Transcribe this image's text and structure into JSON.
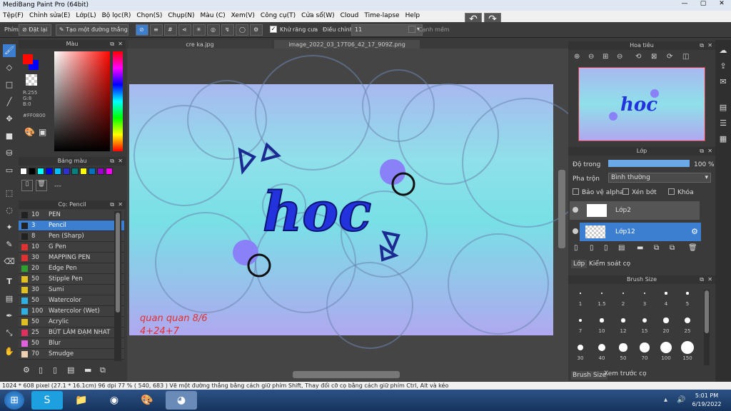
{
  "app": {
    "title": "MediBang Paint Pro (64bit)"
  },
  "window": {
    "minimize": "—",
    "maximize": "▢",
    "close": "✕"
  },
  "menu": [
    "Tệp(F)",
    "Chỉnh sửa(E)",
    "Lớp(L)",
    "Bộ lọc(R)",
    "Chọn(S)",
    "Chụp(N)",
    "Màu (C)",
    "Xem(V)",
    "Công cụ(T)",
    "Cửa sổ(W)",
    "Cloud",
    "Time-lapse",
    "Help"
  ],
  "options": {
    "label_phim": "Phím",
    "reset": "Đặt lại",
    "line": "Tạo một đường thẳng",
    "antialias": "Khử răng cưa",
    "adjust_label": "Điều chỉnh",
    "adjust_value": "11",
    "smooth": "Cạnh mềm"
  },
  "color_panel": {
    "title": "Màu",
    "r": "R:255",
    "g": "G:8",
    "b": "B:0",
    "hex": "#FF0800",
    "primary": "#ff0800",
    "secondary": "#0000ff"
  },
  "palette_panel": {
    "title": "Bảng màu",
    "text": "---",
    "swatches": [
      "#ffffff",
      "#000000",
      "#00ffff",
      "#0000ff",
      "#00bfff",
      "#3030d0",
      "#008080",
      "#ffff00",
      "#0070c0",
      "#9900cc",
      "#ff00ff"
    ]
  },
  "brush_panel": {
    "title": "Cọ: Pencil",
    "items": [
      {
        "size": "10",
        "name": "PEN",
        "color": "#222222"
      },
      {
        "size": "3",
        "name": "Pencil",
        "color": "#222222",
        "selected": true
      },
      {
        "size": "8",
        "name": "Pen (Sharp)",
        "color": "#222222"
      },
      {
        "size": "10",
        "name": "G Pen",
        "color": "#e03030"
      },
      {
        "size": "30",
        "name": "MAPPING PEN",
        "color": "#e03030"
      },
      {
        "size": "20",
        "name": "Edge Pen",
        "color": "#30a030"
      },
      {
        "size": "50",
        "name": "Stipple Pen",
        "color": "#e0c020"
      },
      {
        "size": "30",
        "name": "Sumi",
        "color": "#e0c020"
      },
      {
        "size": "50",
        "name": "Watercolor",
        "color": "#30b0e0"
      },
      {
        "size": "100",
        "name": "Watercolor (Wet)",
        "color": "#30b0e0"
      },
      {
        "size": "50",
        "name": "Acrylic",
        "color": "#e0c020"
      },
      {
        "size": "25",
        "name": "BÚT LÀM ĐẠM NHAT",
        "color": "#e03060"
      },
      {
        "size": "50",
        "name": "Blur",
        "color": "#e060e0"
      },
      {
        "size": "70",
        "name": "Smudge",
        "color": "#f0d0b0"
      }
    ]
  },
  "tabs": [
    "cre ka.jpg",
    "image_2022_03_17T06_42_17_909Z.png"
  ],
  "canvas": {
    "word": "hoc",
    "signature": "quan quan 8/6",
    "signature2": "4+24+7"
  },
  "navigator": {
    "title": "Hoa tiêu"
  },
  "layer_panel": {
    "title": "Lớp",
    "opacity_label": "Độ trong",
    "opacity_value": "100 %",
    "opacity_fraction": 1.0,
    "blend_label": "Pha trộn",
    "blend_value": "Bình thường",
    "protect_alpha": "Bảo vệ alpha",
    "clip": "Xén bớt",
    "lock": "Khóa",
    "layers": [
      {
        "name": "Lớp2",
        "selected": false
      },
      {
        "name": "Lớp12",
        "selected": true
      }
    ],
    "tab_layer": "Lớp",
    "tab_control": "Kiểm soát cọ"
  },
  "brush_size": {
    "title": "Brush Size",
    "sizes": [
      "1",
      "1.5",
      "2",
      "3",
      "4",
      "5",
      "7",
      "10",
      "12",
      "15",
      "20",
      "25",
      "30",
      "40",
      "50",
      "70",
      "100",
      "150"
    ],
    "tab_size": "Brush Size",
    "tab_preview": "Xem trước cọ"
  },
  "status": {
    "text": "1024 * 608 pixel  (27.1 * 16.1cm)  96 dpi  77 %  ( 540, 683 )  Vẽ một đường thẳng bằng cách giữ phím Shift, Thay đổi cỡ cọ bằng cách giữ phím Ctrl, Alt và kéo"
  },
  "taskbar": {
    "time": "5:01 PM",
    "date": "6/19/2022"
  }
}
